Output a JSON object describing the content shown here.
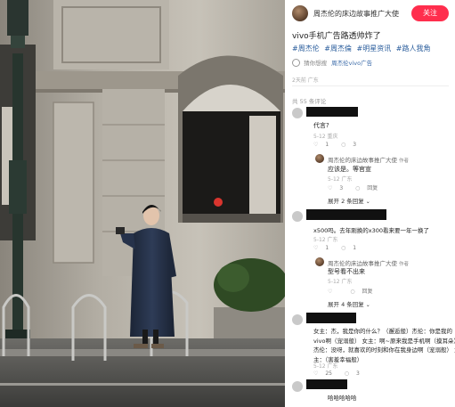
{
  "post": {
    "author_name": "周杰伦的床边故事推广大使",
    "follow_label": "关注",
    "title": "vivo手机广告路透帅炸了",
    "tags": [
      "#周杰伦",
      "#周杰倫",
      "#明星资讯",
      "#路人我角"
    ],
    "guess_label": "猜你想搜",
    "guess_source": "周杰伦vivo广告",
    "ad_note": "2天前 广东",
    "comment_count": "共 55 条评论"
  },
  "comments": [
    {
      "text": "代言?",
      "meta": "5-12 重庆",
      "likes": "1",
      "replies": "3",
      "reply": {
        "name": "周杰伦的床边故事推广大使",
        "author_tag": "作者",
        "text": "应该是。等官宣",
        "meta": "5-12 广东",
        "likes": "3",
        "reply_label": "回复"
      },
      "expand_label": "展开 2 条回复"
    },
    {
      "text": "x500吗。去年刚换的x300看来要一年一换了",
      "meta": "5-12 广东",
      "likes": "1",
      "replies": "1",
      "reply": {
        "name": "周杰伦的床边故事推广大使",
        "author_tag": "作者",
        "text": "型号看不出来",
        "meta": "5-12 广东",
        "likes": "",
        "reply_label": "回复"
      },
      "expand_label": "展开 4 条回复"
    },
    {
      "text": "女主：杰，我是你的什么？（邂逅般）杰伦：你是我的vivo啊（宠溺般） 女主：啊~原来我是手机啊（摸耳朵） 杰伦：没呀，就喜欢的时刻和你在我身边啊（宠溺般） 女主：（害羞幸福般）",
      "meta": "5-12 广东",
      "likes": "25",
      "replies": "3"
    },
    {
      "text": "哈哈哈哈哈"
    }
  ],
  "icons": {
    "like": "heart-icon",
    "comment": "comment-icon",
    "guess": "search-icon",
    "chevron": "chevron-down-icon"
  },
  "colors": {
    "follow_button": "#ff2e4d",
    "tag_text": "#2a5d9c",
    "redaction": "#111111"
  }
}
